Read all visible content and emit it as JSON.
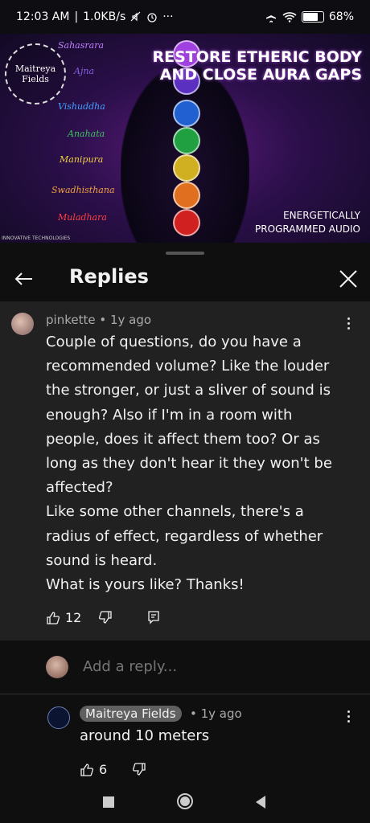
{
  "status_bar": {
    "time": "12:03 AM",
    "network_speed": "1.0KB/s",
    "battery": "68%",
    "icons": [
      "mute-icon",
      "alarm-icon",
      "more-icon",
      "airplane-icon",
      "wifi-icon",
      "battery-icon"
    ]
  },
  "video": {
    "channel_logo_text": "Maitreya Fields",
    "title_line1": "RESTORE ETHERIC BODY",
    "title_line2": "AND CLOSE AURA GAPS",
    "subtitle_line1": "ENERGETICALLY",
    "subtitle_line2": "PROGRAMMED AUDIO",
    "brand": "INNOVATIVE TECHNOLOGIES",
    "chakra_labels": [
      "Sahasrara",
      "Ajna",
      "Vishuddha",
      "Anahata",
      "Manipura",
      "Swadhisthana",
      "Muladhara"
    ]
  },
  "header": {
    "title": "Replies"
  },
  "comment": {
    "author": "pinkette",
    "time": "• 1y ago",
    "paragraphs": [
      "Couple of questions, do you have a recommended volume? Like the louder the stronger, or just a sliver of sound is enough? Also if I'm in a room with people, does it affect them too? Or as long as they don't hear it they won't be affected?",
      "Like some other channels, there's a radius of effect, regardless of whether sound is heard.",
      "What is yours like? Thanks!"
    ],
    "like_count": "12"
  },
  "add_reply": {
    "placeholder": "Add a reply..."
  },
  "reply": {
    "author": "Maitreya Fields",
    "time": "• 1y ago",
    "text": "around 10 meters",
    "like_count": "6"
  },
  "colors": {
    "background": "#0f0f0f",
    "panel": "#212121",
    "owner_chip": "#606060",
    "secondary_text": "#aaaaaa"
  }
}
